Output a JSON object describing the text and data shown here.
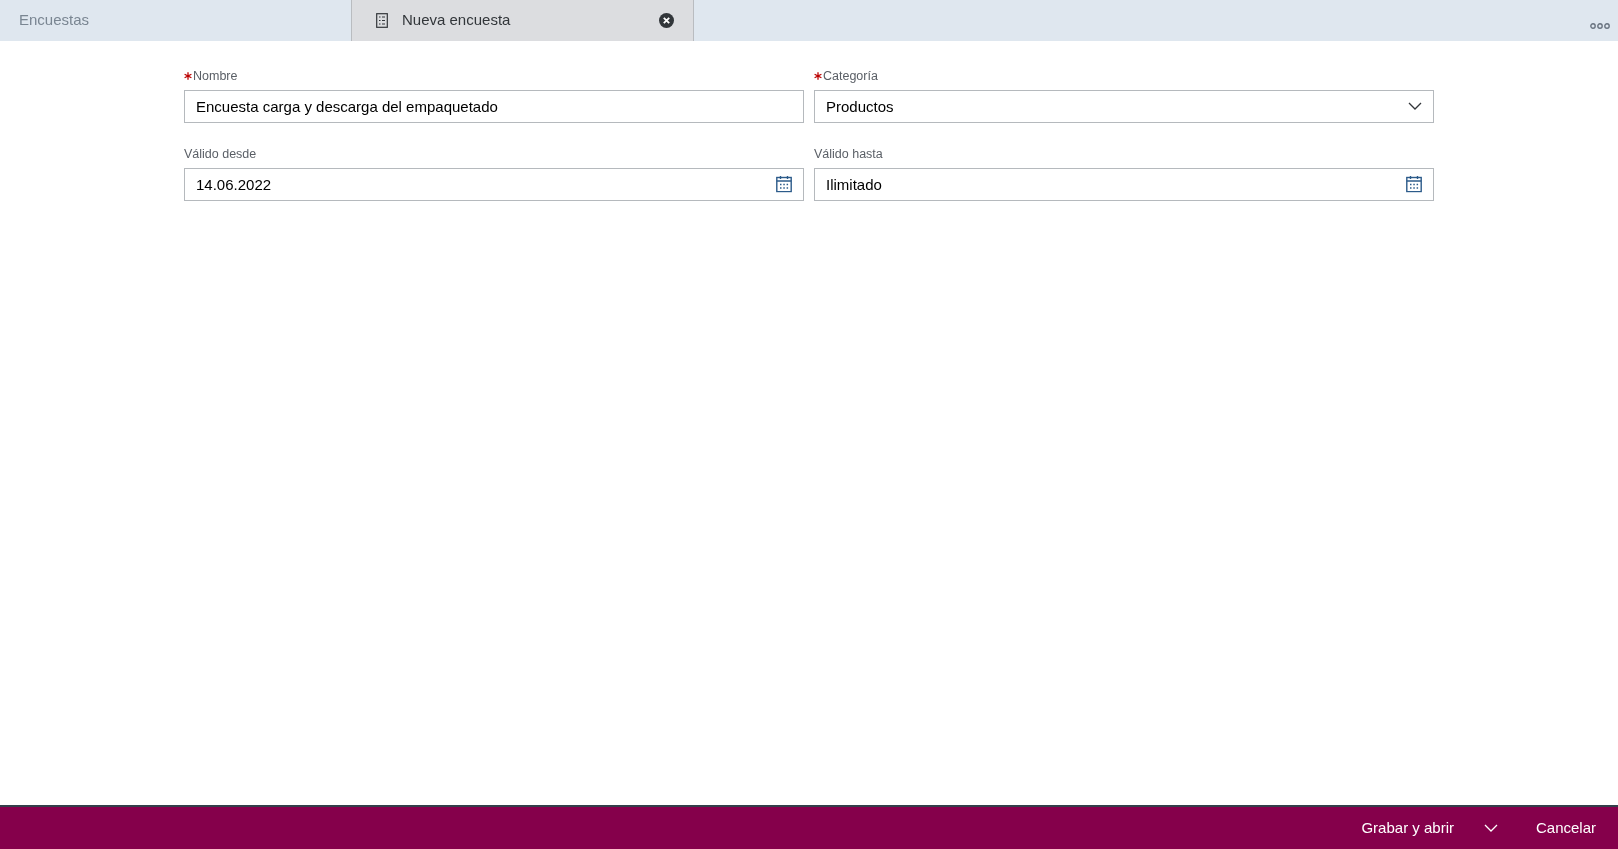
{
  "tabs": [
    {
      "label": "Encuestas",
      "selected": false,
      "icon": false,
      "closable": false
    },
    {
      "label": "Nueva encuesta",
      "selected": true,
      "icon": true,
      "closable": true
    }
  ],
  "fields": [
    {
      "label": "Nombre",
      "required": true,
      "kind": "text",
      "value": "Encuesta carga y descarga del empaquetado"
    },
    {
      "label": "Categoría",
      "required": true,
      "kind": "select",
      "value": "Productos"
    },
    {
      "label": "Válido desde",
      "required": false,
      "kind": "date",
      "value": "14.06.2022"
    },
    {
      "label": "Válido hasta",
      "required": false,
      "kind": "date",
      "value": "Ilimitado"
    }
  ],
  "footer": {
    "primary": "Grabar y abrir",
    "secondary": "Cancelar"
  }
}
